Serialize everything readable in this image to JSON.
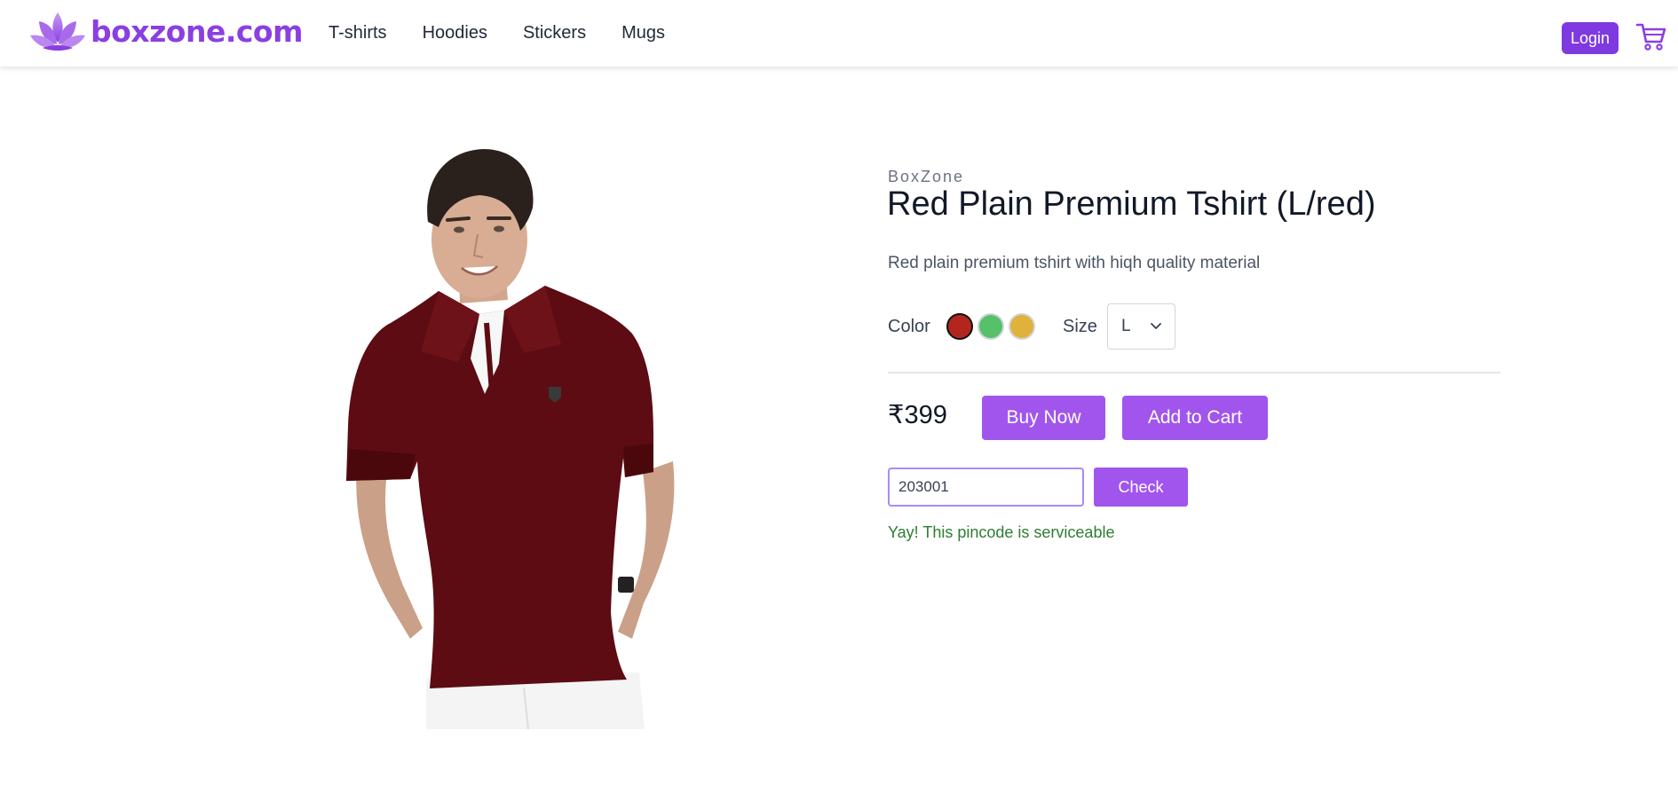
{
  "brand": {
    "name": "boxzone.com",
    "logo_icon": "lotus-logo-icon",
    "color": "#8b3fe0"
  },
  "nav": {
    "links": [
      "T-shirts",
      "Hoodies",
      "Stickers",
      "Mugs"
    ],
    "login_label": "Login",
    "cart_icon": "cart-icon"
  },
  "product": {
    "brand": "BoxZone",
    "title": "Red Plain Premium Tshirt (L/red)",
    "description": "Red plain premium tshirt with hiqh quality material",
    "color_label": "Color",
    "colors": [
      "#b3261e",
      "#55c26a",
      "#e0b23c"
    ],
    "selected_color": "#b3261e",
    "size_label": "Size",
    "size_selected": "L",
    "price": "₹399",
    "buy_now_label": "Buy Now",
    "add_to_cart_label": "Add to Cart"
  },
  "pincode": {
    "value": "203001",
    "check_label": "Check",
    "status_message": "Yay! This pincode is serviceable",
    "status_color": "#2e7d32"
  },
  "theme": {
    "accent": "#a155ec",
    "login_bg": "#7e3ae0"
  }
}
